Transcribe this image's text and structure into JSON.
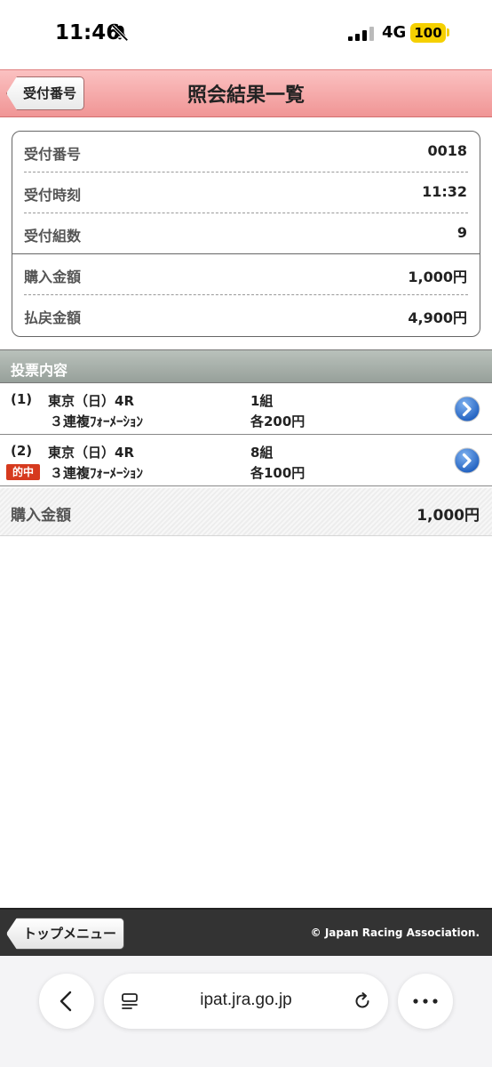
{
  "status_bar": {
    "time": "11:46",
    "network": "4G",
    "battery": "100"
  },
  "header": {
    "back_label": "受付番号",
    "title": "照会結果一覧"
  },
  "info": {
    "rows": [
      {
        "label": "受付番号",
        "value": "0018"
      },
      {
        "label": "受付時刻",
        "value": "11:32"
      },
      {
        "label": "受付組数",
        "value": "9"
      },
      {
        "label": "購入金額",
        "value": "1,000円"
      },
      {
        "label": "払戻金額",
        "value": "4,900円"
      }
    ]
  },
  "section": {
    "title": "投票内容"
  },
  "entries": [
    {
      "num": "(1)",
      "venue": "東京（日）4R",
      "bet_type": "３連複ﾌｫｰﾒｰｼｮﾝ",
      "groups": "1組",
      "unit": "各200円",
      "hit": false
    },
    {
      "num": "(2)",
      "venue": "東京（日）4R",
      "bet_type": "３連複ﾌｫｰﾒｰｼｮﾝ",
      "groups": "8組",
      "unit": "各100円",
      "hit": true,
      "hit_label": "的中"
    }
  ],
  "total": {
    "label": "購入金額",
    "value": "1,000円"
  },
  "footer": {
    "top_menu": "トップメニュー",
    "copyright": "© Japan Racing Association."
  },
  "browser": {
    "url": "ipat.jra.go.jp"
  },
  "colors": {
    "header_pink": "#f09595",
    "hit_red": "#d63a1e",
    "arrow_blue": "#2f6fc9",
    "battery_yellow": "#f5d000"
  }
}
